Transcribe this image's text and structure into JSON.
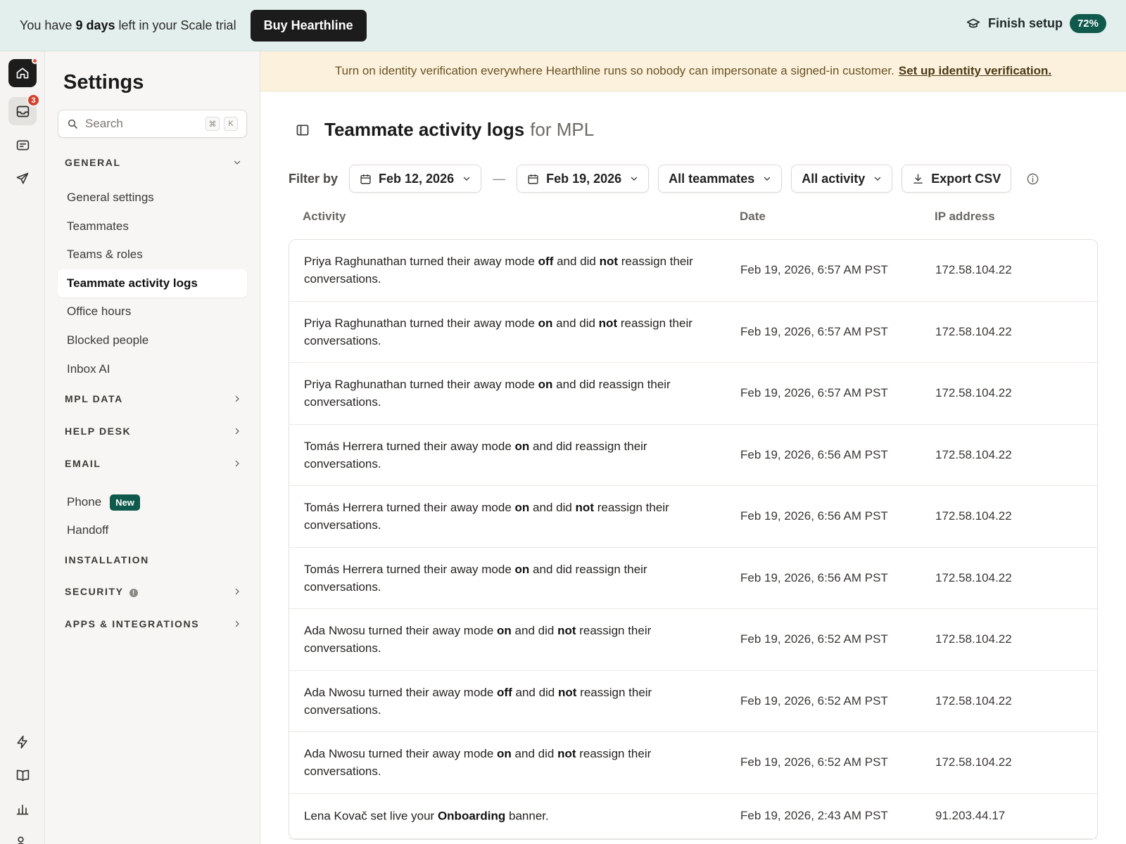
{
  "trial": {
    "prefix": "You have",
    "days": "9 days",
    "suffix": "left in your Scale trial",
    "buy_label": "Buy Hearthline",
    "setup_label": "Finish setup",
    "setup_percent": "72%"
  },
  "rail": {
    "inbox_badge": "3"
  },
  "sidebar": {
    "title": "Settings",
    "search_placeholder": "Search",
    "search_kbd": [
      "⌘",
      "K"
    ],
    "sections": {
      "general": "GENERAL",
      "mpl_data": "MPL DATA",
      "help_desk": "HELP DESK",
      "email": "EMAIL",
      "installation": "INSTALLATION",
      "security": "SECURITY",
      "apps": "APPS & INTEGRATIONS"
    },
    "items": {
      "general_settings": "General settings",
      "teammates": "Teammates",
      "teams_roles": "Teams & roles",
      "activity_logs": "Teammate activity logs",
      "office_hours": "Office hours",
      "blocked_people": "Blocked people",
      "inbox_ai": "Inbox AI",
      "phone": "Phone",
      "phone_badge": "New",
      "handoff": "Handoff"
    }
  },
  "notice": {
    "text": "Turn on identity verification everywhere Hearthline runs so nobody can impersonate a signed-in customer.",
    "link": "Set up identity verification."
  },
  "page": {
    "title": "Teammate activity logs",
    "subtitle": "for MPL"
  },
  "filters": {
    "label": "Filter by",
    "start_date": "Feb 12, 2026",
    "separator": "—",
    "end_date": "Feb 19, 2026",
    "teammates": "All teammates",
    "activity": "All activity",
    "export": "Export CSV"
  },
  "table": {
    "columns": [
      "Activity",
      "Date",
      "IP address"
    ],
    "rows": [
      {
        "parts": [
          [
            "Priya Raghunathan turned their away mode ",
            false
          ],
          [
            "off",
            true
          ],
          [
            " and did ",
            false
          ],
          [
            "not",
            true
          ],
          [
            " reassign their conversations.",
            false
          ]
        ],
        "date": "Feb 19, 2026, 6:57 AM PST",
        "ip": "172.58.104.22"
      },
      {
        "parts": [
          [
            "Priya Raghunathan turned their away mode ",
            false
          ],
          [
            "on",
            true
          ],
          [
            " and did ",
            false
          ],
          [
            "not",
            true
          ],
          [
            " reassign their conversations.",
            false
          ]
        ],
        "date": "Feb 19, 2026, 6:57 AM PST",
        "ip": "172.58.104.22"
      },
      {
        "parts": [
          [
            "Priya Raghunathan turned their away mode ",
            false
          ],
          [
            "on",
            true
          ],
          [
            " and did reassign their conversations.",
            false
          ]
        ],
        "date": "Feb 19, 2026, 6:57 AM PST",
        "ip": "172.58.104.22"
      },
      {
        "parts": [
          [
            "Tomás Herrera turned their away mode ",
            false
          ],
          [
            "on",
            true
          ],
          [
            " and did reassign their conversations.",
            false
          ]
        ],
        "date": "Feb 19, 2026, 6:56 AM PST",
        "ip": "172.58.104.22"
      },
      {
        "parts": [
          [
            "Tomás Herrera turned their away mode ",
            false
          ],
          [
            "on",
            true
          ],
          [
            " and did ",
            false
          ],
          [
            "not",
            true
          ],
          [
            " reassign their conversations.",
            false
          ]
        ],
        "date": "Feb 19, 2026, 6:56 AM PST",
        "ip": "172.58.104.22"
      },
      {
        "parts": [
          [
            "Tomás Herrera turned their away mode ",
            false
          ],
          [
            "on",
            true
          ],
          [
            " and did reassign their conversations.",
            false
          ]
        ],
        "date": "Feb 19, 2026, 6:56 AM PST",
        "ip": "172.58.104.22"
      },
      {
        "parts": [
          [
            "Ada Nwosu turned their away mode ",
            false
          ],
          [
            "on",
            true
          ],
          [
            " and did ",
            false
          ],
          [
            "not",
            true
          ],
          [
            " reassign their conversations.",
            false
          ]
        ],
        "date": "Feb 19, 2026, 6:52 AM PST",
        "ip": "172.58.104.22"
      },
      {
        "parts": [
          [
            "Ada Nwosu turned their away mode ",
            false
          ],
          [
            "off",
            true
          ],
          [
            " and did ",
            false
          ],
          [
            "not",
            true
          ],
          [
            " reassign their conversations.",
            false
          ]
        ],
        "date": "Feb 19, 2026, 6:52 AM PST",
        "ip": "172.58.104.22"
      },
      {
        "parts": [
          [
            "Ada Nwosu turned their away mode ",
            false
          ],
          [
            "on",
            true
          ],
          [
            " and did ",
            false
          ],
          [
            "not",
            true
          ],
          [
            " reassign their conversations.",
            false
          ]
        ],
        "date": "Feb 19, 2026, 6:52 AM PST",
        "ip": "172.58.104.22"
      },
      {
        "parts": [
          [
            "Lena Kovač set live your ",
            false
          ],
          [
            "Onboarding",
            true
          ],
          [
            " banner.",
            false
          ]
        ],
        "date": "Feb 19, 2026, 2:43 AM PST",
        "ip": "91.203.44.17"
      }
    ]
  },
  "colors": {
    "trial_bg": "#e3efec",
    "accent": "#0f5a4c",
    "notice_bg": "#fbf1dc",
    "badge_red": "#d5412c"
  }
}
